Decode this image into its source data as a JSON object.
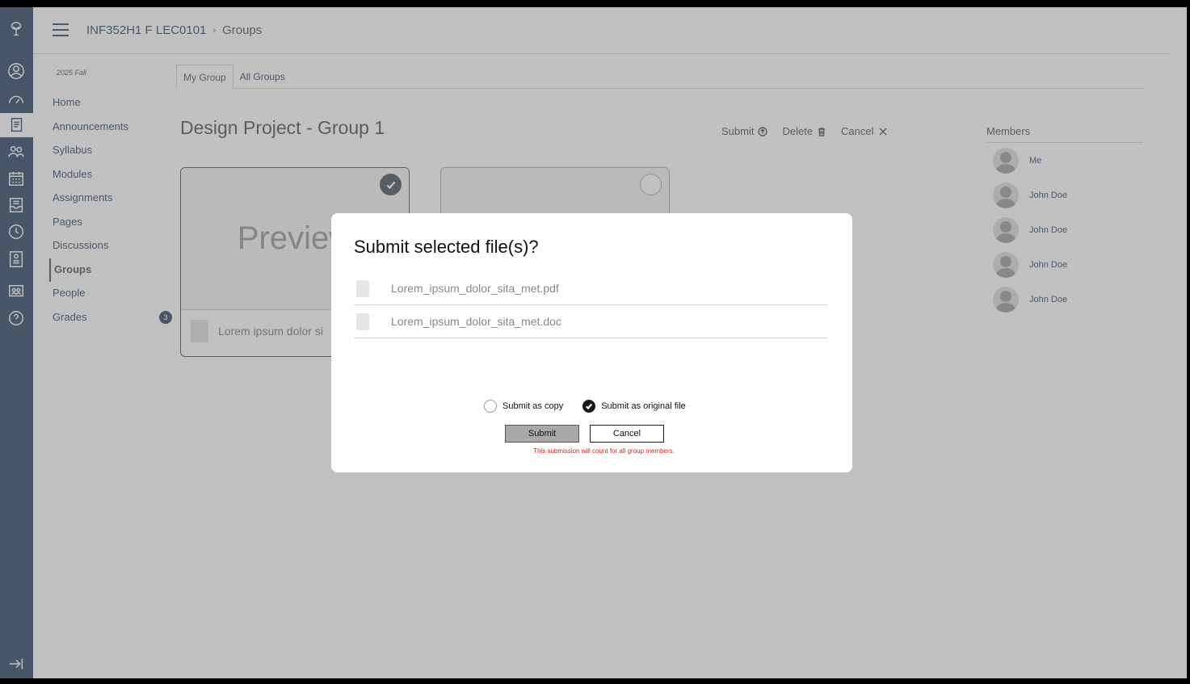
{
  "breadcrumb": {
    "course": "INF352H1 F LEC0101",
    "separator": "›",
    "current": "Groups"
  },
  "course_nav": {
    "term": "2025 Fall",
    "items": [
      {
        "label": "Home"
      },
      {
        "label": "Announcements"
      },
      {
        "label": "Syllabus"
      },
      {
        "label": "Modules"
      },
      {
        "label": "Assignments"
      },
      {
        "label": "Pages"
      },
      {
        "label": "Discussions"
      },
      {
        "label": "Groups"
      },
      {
        "label": "People"
      },
      {
        "label": "Grades",
        "badge": "3"
      }
    ]
  },
  "tabs": [
    {
      "label": "My Group"
    },
    {
      "label": "All Groups"
    }
  ],
  "page_title": "Design Project - Group 1",
  "actions": {
    "submit": "Submit",
    "delete": "Delete",
    "cancel": "Cancel"
  },
  "cards": [
    {
      "preview_text": "Preview",
      "file_name": "Lorem ipsum dolor si",
      "selected": true
    },
    {
      "preview_text": "",
      "file_name": "",
      "selected": false
    }
  ],
  "members": {
    "title": "Members",
    "list": [
      {
        "name": "Me"
      },
      {
        "name": "John Doe"
      },
      {
        "name": "John Doe"
      },
      {
        "name": "John Doe"
      },
      {
        "name": "John Doe"
      }
    ]
  },
  "modal": {
    "title": "Submit selected file(s)?",
    "files": [
      {
        "name": "Lorem_ipsum_dolor_sita_met.pdf"
      },
      {
        "name": "Lorem_ipsum_dolor_sita_met.doc"
      }
    ],
    "option_copy": "Submit as copy",
    "option_original": "Submit as original file",
    "selected_option": "Submit as original file",
    "submit_label": "Submit",
    "cancel_label": "Cancel",
    "note": "This submission will count for all group members."
  },
  "colors": {
    "brand": "#0e2a52",
    "note": "#c62828"
  }
}
